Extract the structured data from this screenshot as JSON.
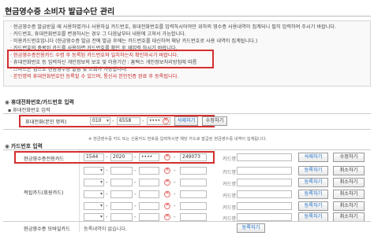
{
  "page_title": "현금영수증 소비자 발급수단 관리",
  "info_lines": [
    "· 현금영수증 발급받을 때 사용하였거나 사용하실 카드번호, 휴대전화번호를 입력하시어야만 위하의 영수증 사용내역이 집계되니 필히 입력하여 주시기 바랍니다.",
    "· 카드번호, 휴대전화번호를 변경하시는 경우 그 다음날부터 내용에 고쳐서 가능합니다.",
    "· 이용카드번호입니다 (현금영수증 발급 전에 발급 후에는 카드번호를 대신하여 해당 카드번호로 사용 내역이 집계됩니다.)",
    "· 카드번호의 중복된 카드를 사용하면 카드번호를 확인 후 재입력 하시기 바랍니다.",
    "· 현금영수증전용카드 수령 후 등록된 카드번호와 일치하는지 확인하시기 바랍니다.",
    "· 휴대전화번호 등 입력하신 개인정보의 보호 및 이용기간 : 홈택스 개인정보처리방침에 따름",
    "· 스마트폰 앱으로 현금영수증 발급 및 조회가 가능합니다.",
    "· 본인명의 휴대전화번호만 등록할 수 있으며, 통신사 본인인증 완료 후 등록됩니다."
  ],
  "phone_section": {
    "heading": "휴대전화번호/카드번호 입력",
    "sub_heading": "휴대전화번호 입력",
    "label": "휴대전화(본인 명의)",
    "prefix": "010",
    "middle": "6558",
    "last": "••••",
    "delete_label": "삭제하기",
    "edit_label": "수정하기"
  },
  "card_section": {
    "heading": "카드번호 입력",
    "note": "※ 현금영수증 카드 또는 신용카드 번호를 입력하시면 해당 카드로 발급된 현금영수증 내역이 집계됩니다.",
    "dedicated_label": "현금영수증전용카드",
    "dedicated_card": [
      "1544",
      "2020",
      "••••",
      "249073"
    ],
    "card_type_label": "카드명",
    "delete_label": "삭제하기",
    "edit_label": "수정하기",
    "register_label": "등록하기",
    "cancel_label": "취소하기",
    "other_label": "적립카드(회원카드)",
    "mobile_label": "현금영수증 모바일카드",
    "mobile_value": "등록내역이 없습니다."
  }
}
